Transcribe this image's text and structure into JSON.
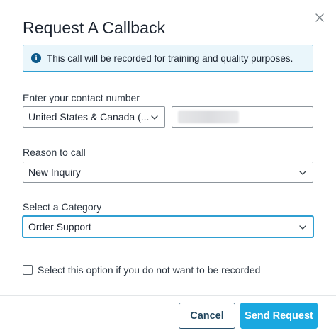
{
  "dialog": {
    "title": "Request A Callback",
    "close_icon": "close-icon"
  },
  "banner": {
    "icon": "info-icon",
    "icon_glyph": "i",
    "message": "This call will be recorded for training and quality purposes."
  },
  "contact": {
    "label": "Enter your contact number",
    "country_value": "United States & Canada (...",
    "phone_value": ""
  },
  "reason": {
    "label": "Reason to call",
    "value": "New Inquiry"
  },
  "category": {
    "label": "Select a Category",
    "value": "Order Support"
  },
  "recording_opt_out": {
    "label": "Select this option if you do not want to be recorded",
    "checked": false
  },
  "footer": {
    "cancel_label": "Cancel",
    "send_label": "Send Request"
  },
  "colors": {
    "accent": "#1aa8e0",
    "banner_border": "#2f9fd2",
    "banner_bg": "#eaf6fb",
    "cancel_border": "#27506e"
  }
}
